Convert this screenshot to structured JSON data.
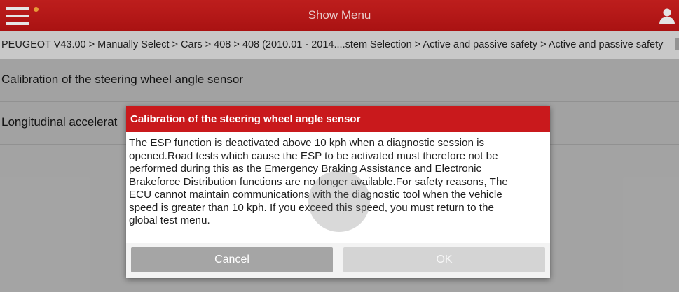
{
  "header": {
    "title": "Show Menu",
    "menu_icon": "hamburger-icon",
    "notification_dot_color": "#f3a33b",
    "user_icon": "user-icon",
    "brand_color": "#c8201f"
  },
  "breadcrumb": {
    "text": "PEUGEOT V43.00 > Manually Select > Cars > 408 > 408 (2010.01 - 2014....stem Selection > Active and passive safety > Active and passive safety"
  },
  "list": {
    "items": [
      {
        "label": "Calibration of the steering wheel angle sensor"
      },
      {
        "label": "Longitudinal accelerat"
      }
    ]
  },
  "dialog": {
    "title": "Calibration of the steering wheel angle sensor",
    "lines": [
      "The ESP function is deactivated above 10 kph when a diagnostic session is",
      "opened.Road tests which cause the ESP to be activated must therefore not be",
      "performed during this as the Emergency Braking Assistance and Electronic",
      "Brakeforce Distribution functions are no longer available.For safety reasons, The",
      "ECU cannot maintain communications with the diagnostic tool when the vehicle",
      "speed is greater than 10 kph. If you exceed this speed, you must return to the",
      "global test menu."
    ],
    "cancel_label": "Cancel",
    "ok_label": "OK"
  }
}
